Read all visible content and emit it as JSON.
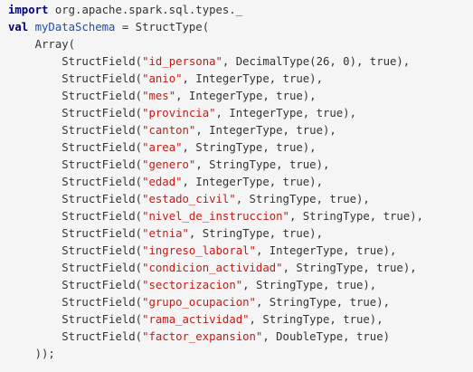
{
  "code": {
    "import_keyword": "import",
    "import_path": " org.apache.spark.sql.types._",
    "val_keyword": "val",
    "schema_name": "myDataSchema",
    "schema_assign": " = StructType(",
    "array_open": "    Array(",
    "field_prefix": "        StructField(",
    "fields": [
      {
        "name": "\"id_persona\"",
        "rest": ", DecimalType(26, 0), true),"
      },
      {
        "name": "\"anio\"",
        "rest": ", IntegerType, true),"
      },
      {
        "name": "\"mes\"",
        "rest": ", IntegerType, true),"
      },
      {
        "name": "\"provincia\"",
        "rest": ", IntegerType, true),"
      },
      {
        "name": "\"canton\"",
        "rest": ", IntegerType, true),"
      },
      {
        "name": "\"area\"",
        "rest": ", StringType, true),"
      },
      {
        "name": "\"genero\"",
        "rest": ", StringType, true),"
      },
      {
        "name": "\"edad\"",
        "rest": ", IntegerType, true),"
      },
      {
        "name": "\"estado_civil\"",
        "rest": ", StringType, true),"
      },
      {
        "name": "\"nivel_de_instruccion\"",
        "rest": ", StringType, true),"
      },
      {
        "name": "\"etnia\"",
        "rest": ", StringType, true),"
      },
      {
        "name": "\"ingreso_laboral\"",
        "rest": ", IntegerType, true),"
      },
      {
        "name": "\"condicion_actividad\"",
        "rest": ", StringType, true),"
      },
      {
        "name": "\"sectorizacion\"",
        "rest": ", StringType, true),"
      },
      {
        "name": "\"grupo_ocupacion\"",
        "rest": ", StringType, true),"
      },
      {
        "name": "\"rama_actividad\"",
        "rest": ", StringType, true),"
      },
      {
        "name": "\"factor_expansion\"",
        "rest": ", DoubleType, true)"
      }
    ],
    "closing": "    ));"
  },
  "colors": {
    "background": "#f5f5f5",
    "keyword": "#000080",
    "identifier": "#1f4faa",
    "string": "#c41a16",
    "text": "#333333"
  }
}
